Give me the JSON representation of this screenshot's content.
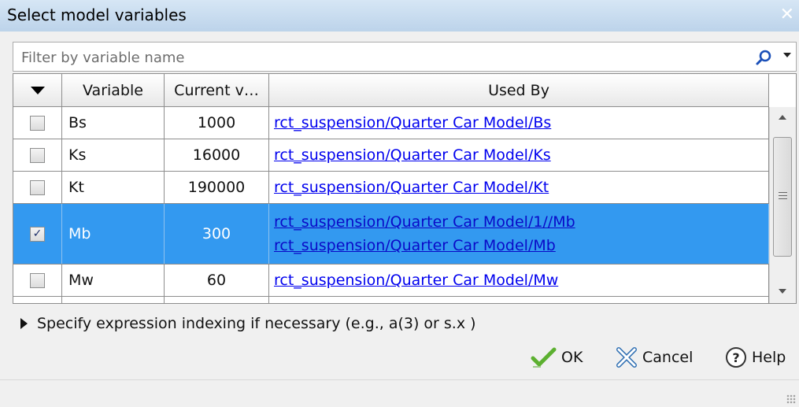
{
  "window": {
    "title": "Select model variables",
    "close_label": "✕"
  },
  "filter": {
    "placeholder": "Filter by variable name"
  },
  "table": {
    "columns": [
      "",
      "Variable",
      "Current v…",
      "Used By"
    ],
    "rows": [
      {
        "checked": false,
        "variable": "Bs",
        "value": "1000",
        "used_by": [
          "rct_suspension/Quarter Car Model/Bs"
        ]
      },
      {
        "checked": false,
        "variable": "Ks",
        "value": "16000",
        "used_by": [
          "rct_suspension/Quarter Car Model/Ks"
        ]
      },
      {
        "checked": false,
        "variable": "Kt",
        "value": "190000",
        "used_by": [
          "rct_suspension/Quarter Car Model/Kt"
        ]
      },
      {
        "checked": true,
        "variable": "Mb",
        "value": "300",
        "used_by": [
          "rct_suspension/Quarter Car Model/1//Mb",
          "rct_suspension/Quarter Car Model/Mb"
        ]
      },
      {
        "checked": false,
        "variable": "Mw",
        "value": "60",
        "used_by": [
          "rct_suspension/Quarter Car Model/Mw"
        ]
      }
    ]
  },
  "expander": {
    "label": "Specify expression indexing if necessary (e.g., a(3) or s.x )"
  },
  "buttons": {
    "ok": "OK",
    "cancel": "Cancel",
    "help": "Help"
  },
  "colors": {
    "selection": "#3399f0",
    "link": "#0000ee",
    "ok_check": "#5cb030",
    "help_ring": "#333333"
  }
}
